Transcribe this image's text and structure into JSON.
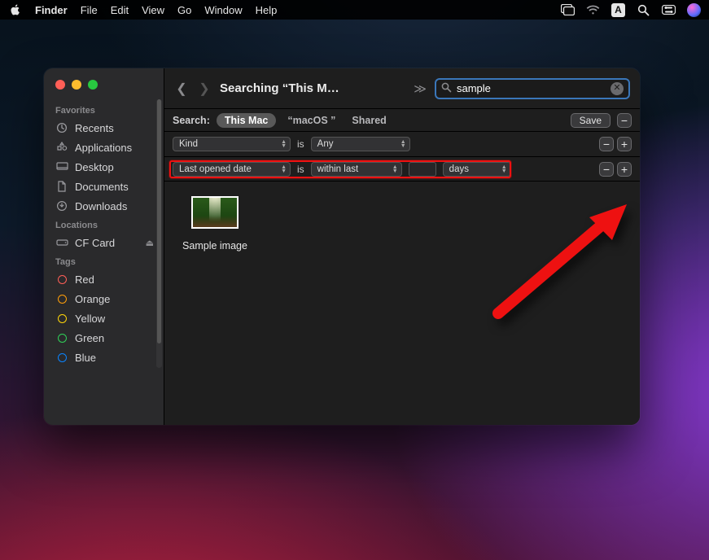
{
  "menubar": {
    "app": "Finder",
    "items": [
      "File",
      "Edit",
      "View",
      "Go",
      "Window",
      "Help"
    ]
  },
  "window": {
    "title": "Searching “This M…",
    "search_value": "sample",
    "search_placeholder": "Search"
  },
  "scopebar": {
    "label": "Search:",
    "scopes": [
      "This Mac",
      "“macOS ”",
      "Shared"
    ],
    "active_index": 0,
    "save_label": "Save"
  },
  "criteria": [
    {
      "attr": "Kind",
      "op": "is",
      "value": "Any",
      "unit": null,
      "has_number": false
    },
    {
      "attr": "Last opened date",
      "op": "is",
      "value": "within last",
      "unit": "days",
      "has_number": true
    }
  ],
  "sidebar": {
    "sections": [
      {
        "title": "Favorites",
        "items": [
          {
            "label": "Recents",
            "icon": "clock-icon"
          },
          {
            "label": "Applications",
            "icon": "apps-icon"
          },
          {
            "label": "Desktop",
            "icon": "desktop-icon"
          },
          {
            "label": "Documents",
            "icon": "doc-icon"
          },
          {
            "label": "Downloads",
            "icon": "downloads-icon"
          }
        ]
      },
      {
        "title": "Locations",
        "items": [
          {
            "label": "CF Card",
            "icon": "drive-icon",
            "eject": true
          }
        ]
      },
      {
        "title": "Tags",
        "items": [
          {
            "label": "Red",
            "color": "#ff5f57"
          },
          {
            "label": "Orange",
            "color": "#ff9f0a"
          },
          {
            "label": "Yellow",
            "color": "#ffd60a"
          },
          {
            "label": "Green",
            "color": "#30d158"
          },
          {
            "label": "Blue",
            "color": "#0a84ff"
          }
        ]
      }
    ]
  },
  "results": [
    {
      "name": "Sample image"
    }
  ]
}
